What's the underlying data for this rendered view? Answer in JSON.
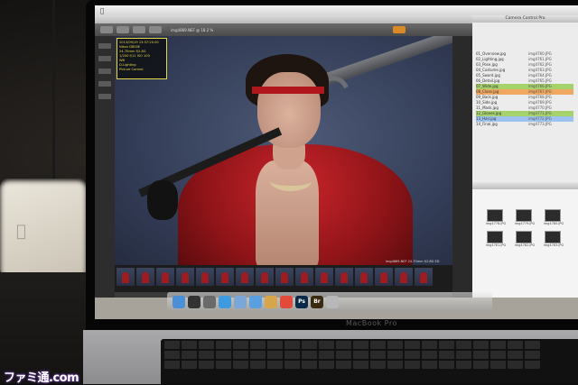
{
  "scene": {
    "laptop_brand": "MacBook Pro",
    "watermark_text": "ファミ通.com"
  },
  "editor": {
    "filename": "img4869.NEF @ 18.2 %",
    "info_lines": [
      "2013/09/19 13:37:20.00",
      "Nikon D800E",
      "24-70mm f/2.8G",
      "1/200 f/11 ISO 100",
      "WB",
      "D-Lighting",
      "Picture Control"
    ],
    "caption": "img4869.NEF 24-70mm f/2.8G ED",
    "filmstrip_count": 16
  },
  "finder": {
    "title": "Camera Control Pro",
    "rows": [
      {
        "left": "01_Overview.jpg",
        "right": "img4760.JPG",
        "highlight": ""
      },
      {
        "left": "02_Lighting.jpg",
        "right": "img4761.JPG",
        "highlight": ""
      },
      {
        "left": "03_Pose.jpg",
        "right": "img4762.JPG",
        "highlight": ""
      },
      {
        "left": "04_Costume.jpg",
        "right": "img4763.JPG",
        "highlight": ""
      },
      {
        "left": "05_Sword.jpg",
        "right": "img4764.JPG",
        "highlight": ""
      },
      {
        "left": "06_Detail.jpg",
        "right": "img4765.JPG",
        "highlight": ""
      },
      {
        "left": "07_Wide.jpg",
        "right": "img4766.JPG",
        "highlight": "green"
      },
      {
        "left": "08_Close.jpg",
        "right": "img4767.JPG",
        "highlight": "orange"
      },
      {
        "left": "09_Back.jpg",
        "right": "img4768.JPG",
        "highlight": ""
      },
      {
        "left": "10_Side.jpg",
        "right": "img4769.JPG",
        "highlight": ""
      },
      {
        "left": "11_Mask.jpg",
        "right": "img4770.JPG",
        "highlight": ""
      },
      {
        "left": "12_Gloves.jpg",
        "right": "img4771.JPG",
        "highlight": "green"
      },
      {
        "left": "13_Hair.jpg",
        "right": "img4772.JPG",
        "highlight": "blue"
      },
      {
        "left": "14_Final.jpg",
        "right": "img4773.JPG",
        "highlight": ""
      }
    ]
  },
  "finder2": {
    "files": [
      "img4778.JPG",
      "img4779.JPG",
      "img4780.JPG",
      "img4781.JPG",
      "img4782.JPG",
      "img4783.JPG"
    ]
  },
  "dock": {
    "apps": [
      {
        "name": "finder",
        "color": "#4a8fd8",
        "label": ""
      },
      {
        "name": "dashboard",
        "color": "#333",
        "label": ""
      },
      {
        "name": "mission-control",
        "color": "#6a6a6a",
        "label": ""
      },
      {
        "name": "safari",
        "color": "#3f9be0",
        "label": ""
      },
      {
        "name": "mail",
        "color": "#7aa6d8",
        "label": ""
      },
      {
        "name": "itunes",
        "color": "#5aa0e0",
        "label": ""
      },
      {
        "name": "preview",
        "color": "#d8a64a",
        "label": ""
      },
      {
        "name": "calendar",
        "color": "#e24a3a",
        "label": ""
      },
      {
        "name": "photoshop",
        "color": "#0b2a4a",
        "label": "Ps"
      },
      {
        "name": "bridge",
        "color": "#3a2a10",
        "label": "Br"
      },
      {
        "name": "trash",
        "color": "#b8b8b8",
        "label": ""
      }
    ]
  }
}
